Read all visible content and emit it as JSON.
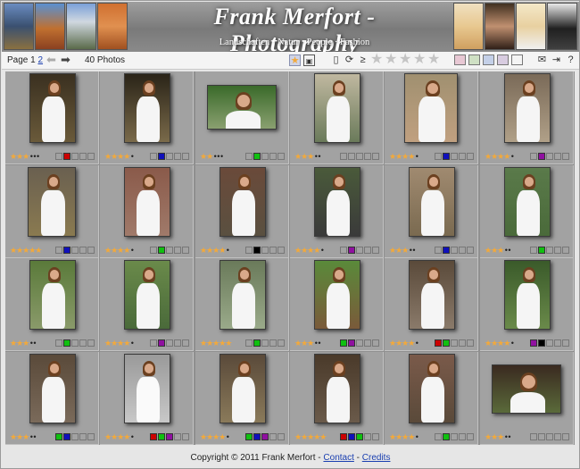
{
  "header": {
    "title": "Frank Merfort - Photography",
    "subtitle": "Landschaften · Natur · People · Fashion"
  },
  "toolbar": {
    "page_prefix": "Page",
    "pages": [
      "1",
      "2"
    ],
    "current_page": "1",
    "photo_count": "40 Photos",
    "prev_icon": "arrow-left-icon",
    "next_icon": "arrow-right-icon",
    "rating_stars": 5,
    "color_filters": [
      "#e8c8d4",
      "#cfe0c4",
      "#c4d0e8",
      "#d8cce0",
      "#f4f4f4"
    ]
  },
  "colors": {
    "red": "#cc0000",
    "blue": "#1010bb",
    "green": "#10c010",
    "purple": "#9010a0",
    "black": "#000000",
    "star": "#f2a93b"
  },
  "photos": [
    {
      "rating": 3,
      "dots": 3,
      "tags": [
        "red"
      ]
    },
    {
      "rating": 4,
      "dots": 1,
      "tags": [
        "blue"
      ]
    },
    {
      "rating": 2,
      "dots": 3,
      "tags": [
        "green"
      ]
    },
    {
      "rating": 3,
      "dots": 2,
      "tags": []
    },
    {
      "rating": 4,
      "dots": 1,
      "tags": [
        "blue"
      ]
    },
    {
      "rating": 4,
      "dots": 1,
      "tags": [
        "purple"
      ]
    },
    {
      "rating": 5,
      "dots": 0,
      "tags": [
        "blue"
      ]
    },
    {
      "rating": 4,
      "dots": 1,
      "tags": [
        "green"
      ]
    },
    {
      "rating": 4,
      "dots": 1,
      "tags": [
        "black"
      ]
    },
    {
      "rating": 4,
      "dots": 1,
      "tags": [
        "purple"
      ]
    },
    {
      "rating": 3,
      "dots": 2,
      "tags": [
        "blue"
      ]
    },
    {
      "rating": 3,
      "dots": 2,
      "tags": [
        "green"
      ]
    },
    {
      "rating": 3,
      "dots": 2,
      "tags": [
        "green"
      ]
    },
    {
      "rating": 4,
      "dots": 1,
      "tags": [
        "purple"
      ]
    },
    {
      "rating": 5,
      "dots": 0,
      "tags": [
        "green"
      ]
    },
    {
      "rating": 3,
      "dots": 2,
      "tags": [
        "green",
        "purple"
      ]
    },
    {
      "rating": 4,
      "dots": 1,
      "tags": [
        "red",
        "green"
      ]
    },
    {
      "rating": 4,
      "dots": 1,
      "tags": [
        "purple",
        "black"
      ]
    },
    {
      "rating": 3,
      "dots": 2,
      "tags": [
        "green",
        "blue"
      ]
    },
    {
      "rating": 4,
      "dots": 1,
      "tags": [
        "red",
        "green",
        "purple"
      ]
    },
    {
      "rating": 4,
      "dots": 1,
      "tags": [
        "green",
        "blue",
        "purple"
      ]
    },
    {
      "rating": 5,
      "dots": 0,
      "tags": [
        "red",
        "blue",
        "green"
      ]
    },
    {
      "rating": 4,
      "dots": 1,
      "tags": [
        "green"
      ]
    },
    {
      "rating": 3,
      "dots": 2,
      "tags": []
    }
  ],
  "footer": {
    "copyright": "Copyright © 2011 Frank Merfort - ",
    "contact": "Contact",
    "separator": " - ",
    "credits": "Credits"
  }
}
